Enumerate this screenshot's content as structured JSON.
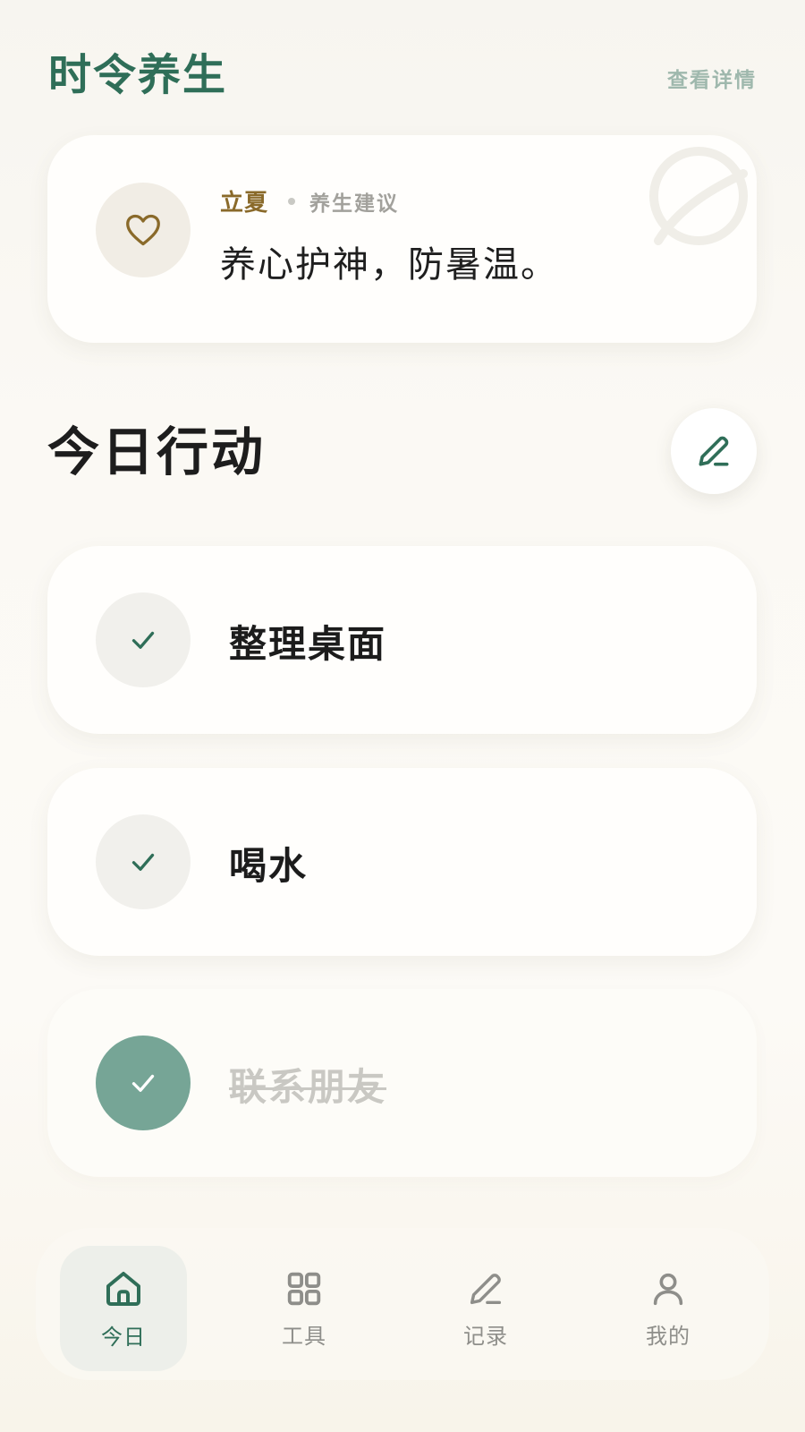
{
  "header": {
    "title": "时令养生",
    "detail_link": "查看详情"
  },
  "advice": {
    "solar_term": "立夏",
    "label": "养生建议",
    "text": "养心护神，防暑温。",
    "icon": "heart-icon"
  },
  "today": {
    "title": "今日行动",
    "edit_icon": "pencil-icon",
    "tasks": [
      {
        "label": "整理桌面",
        "done": false
      },
      {
        "label": "喝水",
        "done": false
      },
      {
        "label": "联系朋友",
        "done": true
      }
    ]
  },
  "tabbar": {
    "items": [
      {
        "label": "今日",
        "icon": "home-icon",
        "active": true
      },
      {
        "label": "工具",
        "icon": "grid-icon",
        "active": false
      },
      {
        "label": "记录",
        "icon": "pencil-icon",
        "active": false
      },
      {
        "label": "我的",
        "icon": "user-icon",
        "active": false
      }
    ]
  },
  "colors": {
    "accent": "#2f6e58",
    "solar_term": "#8a6a2a",
    "done_check": "#76a596",
    "background": "#fbf9f4"
  }
}
